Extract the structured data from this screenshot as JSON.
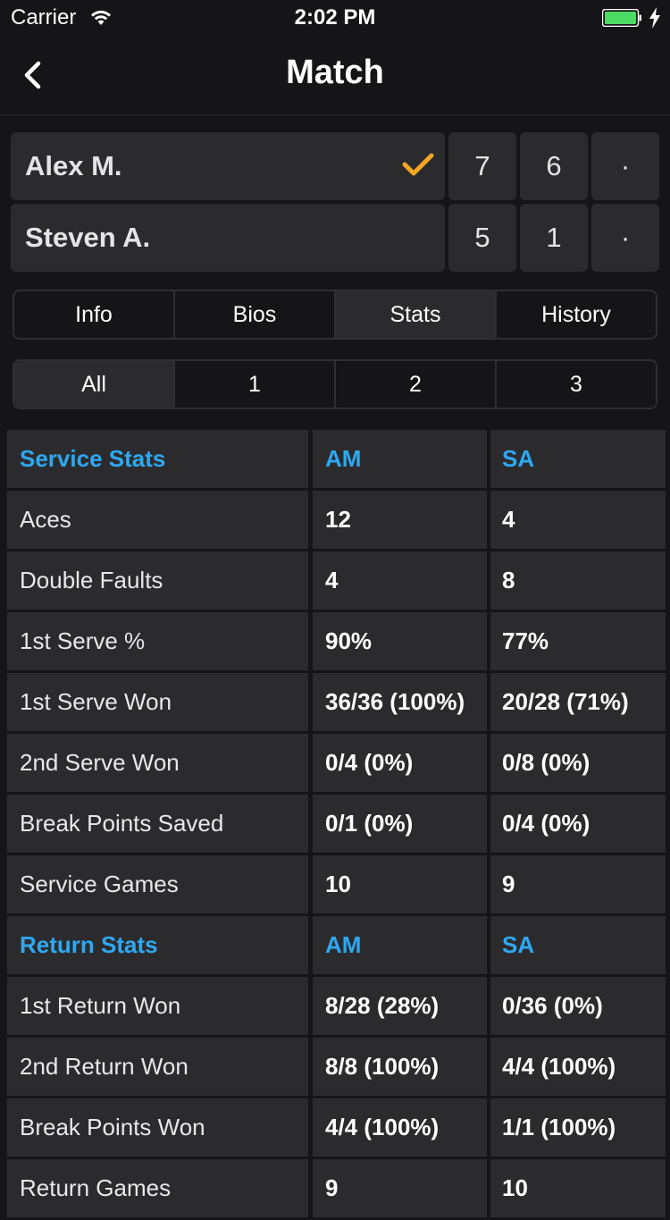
{
  "status_bar": {
    "carrier": "Carrier",
    "time": "2:02 PM",
    "battery_color": "#4cd964"
  },
  "nav": {
    "title": "Match",
    "back_icon": "chevron-left-icon"
  },
  "match": {
    "players": [
      {
        "name": "Alex M.",
        "winner": true,
        "sets": [
          "7",
          "6",
          "·"
        ]
      },
      {
        "name": "Steven A.",
        "winner": false,
        "sets": [
          "5",
          "1",
          "·"
        ]
      }
    ],
    "winner_color": "#f5a623"
  },
  "tabs": {
    "items": [
      "Info",
      "Bios",
      "Stats",
      "History"
    ],
    "active": "Stats"
  },
  "set_filter": {
    "items": [
      "All",
      "1",
      "2",
      "3"
    ],
    "active": "All"
  },
  "stats": {
    "accent_color": "#2fa8f0",
    "service": {
      "header": [
        "Service Stats",
        "AM",
        "SA"
      ],
      "rows": [
        [
          "Aces",
          "12",
          "4"
        ],
        [
          "Double Faults",
          "4",
          "8"
        ],
        [
          "1st Serve %",
          "90%",
          "77%"
        ],
        [
          "1st Serve Won",
          "36/36 (100%)",
          "20/28 (71%)"
        ],
        [
          "2nd Serve Won",
          "0/4 (0%)",
          "0/8 (0%)"
        ],
        [
          "Break Points Saved",
          "0/1 (0%)",
          "0/4 (0%)"
        ],
        [
          "Service Games",
          "10",
          "9"
        ]
      ]
    },
    "return": {
      "header": [
        "Return Stats",
        "AM",
        "SA"
      ],
      "rows": [
        [
          "1st Return Won",
          "8/28 (28%)",
          "0/36 (0%)"
        ],
        [
          "2nd Return Won",
          "8/8 (100%)",
          "4/4 (100%)"
        ],
        [
          "Break Points Won",
          "4/4 (100%)",
          "1/1 (100%)"
        ],
        [
          "Return Games",
          "9",
          "10"
        ]
      ]
    }
  }
}
